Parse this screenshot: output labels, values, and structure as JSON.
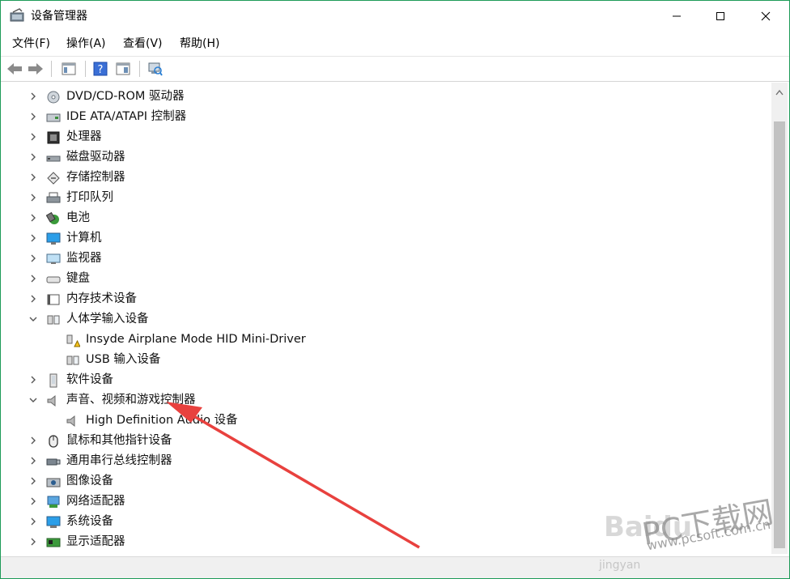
{
  "window": {
    "title": "设备管理器",
    "accent": "#1e9b58"
  },
  "menu": [
    "文件(F)",
    "操作(A)",
    "查看(V)",
    "帮助(H)"
  ],
  "toolbar_icons": [
    "back-icon",
    "forward-icon",
    "properties-icon",
    "help-icon",
    "show-hide-console-tree-icon",
    "scan-hardware-icon"
  ],
  "tree": [
    {
      "label": "DVD/CD-ROM 驱动器",
      "expanded": false,
      "level": 0,
      "icon": "dvd-icon"
    },
    {
      "label": "IDE ATA/ATAPI 控制器",
      "expanded": false,
      "level": 0,
      "icon": "ide-controller-icon"
    },
    {
      "label": "处理器",
      "expanded": false,
      "level": 0,
      "icon": "processor-icon"
    },
    {
      "label": "磁盘驱动器",
      "expanded": false,
      "level": 0,
      "icon": "disk-drive-icon"
    },
    {
      "label": "存储控制器",
      "expanded": false,
      "level": 0,
      "icon": "storage-controller-icon"
    },
    {
      "label": "打印队列",
      "expanded": false,
      "level": 0,
      "icon": "printer-icon"
    },
    {
      "label": "电池",
      "expanded": false,
      "level": 0,
      "icon": "battery-icon"
    },
    {
      "label": "计算机",
      "expanded": false,
      "level": 0,
      "icon": "computer-icon"
    },
    {
      "label": "监视器",
      "expanded": false,
      "level": 0,
      "icon": "monitor-icon"
    },
    {
      "label": "键盘",
      "expanded": false,
      "level": 0,
      "icon": "keyboard-icon"
    },
    {
      "label": "内存技术设备",
      "expanded": false,
      "level": 0,
      "icon": "memory-device-icon"
    },
    {
      "label": "人体学输入设备",
      "expanded": true,
      "level": 0,
      "icon": "hid-icon"
    },
    {
      "label": "Insyde Airplane Mode HID Mini-Driver",
      "level": 1,
      "icon": "hid-warning-icon"
    },
    {
      "label": "USB 输入设备",
      "level": 1,
      "icon": "hid-icon"
    },
    {
      "label": "软件设备",
      "expanded": false,
      "level": 0,
      "icon": "software-device-icon"
    },
    {
      "label": "声音、视频和游戏控制器",
      "expanded": true,
      "level": 0,
      "icon": "speaker-icon"
    },
    {
      "label": "High Definition Audio 设备",
      "level": 1,
      "icon": "speaker-icon"
    },
    {
      "label": "鼠标和其他指针设备",
      "expanded": false,
      "level": 0,
      "icon": "mouse-icon"
    },
    {
      "label": "通用串行总线控制器",
      "expanded": false,
      "level": 0,
      "icon": "usb-icon"
    },
    {
      "label": "图像设备",
      "expanded": false,
      "level": 0,
      "icon": "camera-icon"
    },
    {
      "label": "网络适配器",
      "expanded": false,
      "level": 0,
      "icon": "network-adapter-icon"
    },
    {
      "label": "系统设备",
      "expanded": false,
      "level": 0,
      "icon": "system-device-icon"
    },
    {
      "label": "显示适配器",
      "expanded": false,
      "level": 0,
      "icon": "display-adapter-icon"
    }
  ],
  "annotation": {
    "arrow_color": "#e8413e"
  },
  "watermark": {
    "baidu": "Baidu",
    "brand": "PC下载网",
    "domain": "www.pcsoft.com.cn",
    "jingyan": "jingyan"
  }
}
